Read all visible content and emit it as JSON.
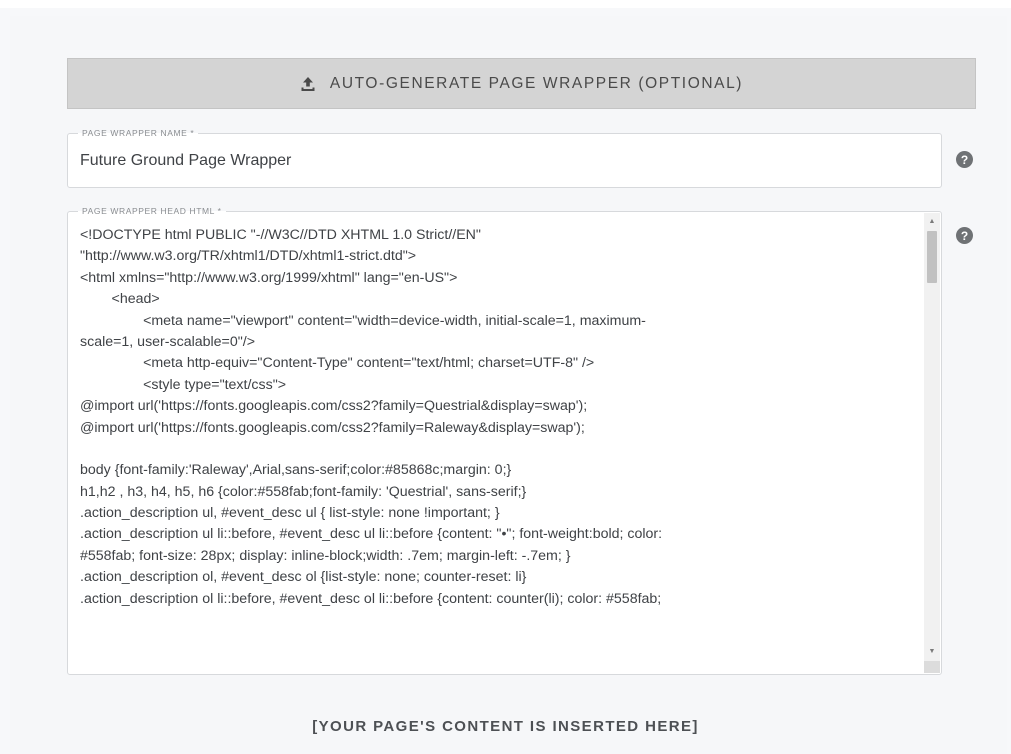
{
  "generate_button": {
    "icon": "upload-icon",
    "label": "AUTO-GENERATE PAGE WRAPPER (OPTIONAL)"
  },
  "name_field": {
    "label": "PAGE WRAPPER NAME *",
    "value": "Future Ground Page Wrapper",
    "help_icon": "question-circle-icon"
  },
  "head_field": {
    "label": "PAGE WRAPPER HEAD HTML *",
    "help_icon": "question-circle-icon",
    "lines": [
      "<!DOCTYPE html PUBLIC \"-//W3C//DTD XHTML 1.0 Strict//EN\"",
      "\"http://www.w3.org/TR/xhtml1/DTD/xhtml1-strict.dtd\">",
      "<html xmlns=\"http://www.w3.org/1999/xhtml\" lang=\"en-US\">",
      "        <head>",
      "                <meta name=\"viewport\" content=\"width=device-width, initial-scale=1, maximum-",
      "scale=1, user-scalable=0\"/>",
      "                <meta http-equiv=\"Content-Type\" content=\"text/html; charset=UTF-8\" />",
      "                <style type=\"text/css\">",
      "@import url('https://fonts.googleapis.com/css2?family=Questrial&display=swap');",
      "@import url('https://fonts.googleapis.com/css2?family=Raleway&display=swap');",
      "",
      "body {font-family:'Raleway',Arial,sans-serif;color:#85868c;margin: 0;}",
      "h1,h2 , h3, h4, h5, h6 {color:#558fab;font-family: 'Questrial', sans-serif;}",
      ".action_description ul, #event_desc ul { list-style: none !important; }",
      ".action_description ul li::before, #event_desc ul li::before {content: \"•\"; font-weight:bold; color:",
      "#558fab; font-size: 28px; display: inline-block;width: .7em; margin-left: -.7em; }",
      ".action_description ol, #event_desc ol {list-style: none; counter-reset: li}",
      ".action_description ol li::before, #event_desc ol li::before {content: counter(li); color: #558fab;"
    ]
  },
  "content_note": "[YOUR PAGE'S CONTENT IS INSERTED HERE]"
}
